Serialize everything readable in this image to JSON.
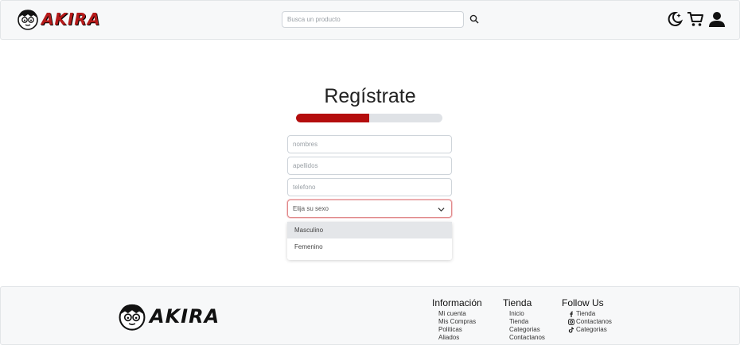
{
  "header": {
    "logo_text": "AKIRA",
    "search_placeholder": "Busca un producto",
    "icons": [
      "moon-icon",
      "cart-icon",
      "user-icon",
      "search-icon"
    ]
  },
  "main": {
    "title": "Regístrate",
    "progress": 0.5,
    "fields": {
      "nombres": "nombres",
      "apellidos": "apellidos",
      "telefono": "telefono"
    },
    "select": {
      "value": "Elija su sexo",
      "options": [
        "Masculino",
        "Femenino"
      ]
    }
  },
  "footer": {
    "logo_text": "AKIRA",
    "informacion": {
      "heading": "Información",
      "links": [
        "Mi cuenta",
        "Mis Compras",
        "Politicas",
        "Aliados"
      ]
    },
    "tienda": {
      "heading": "Tienda",
      "links": [
        "Inicio",
        "Tienda",
        "Categorias",
        "Contactanos"
      ]
    },
    "follow": {
      "heading": "Follow Us",
      "links": [
        {
          "icon": "facebook-icon",
          "label": "Tienda"
        },
        {
          "icon": "instagram-icon",
          "label": "Contactanos"
        },
        {
          "icon": "tiktok-icon",
          "label": "Categorias"
        }
      ]
    }
  },
  "colors": {
    "brand_red": "#b40d0d",
    "progress_track": "#dfe2e6",
    "header_bg": "#f7f8f9"
  }
}
